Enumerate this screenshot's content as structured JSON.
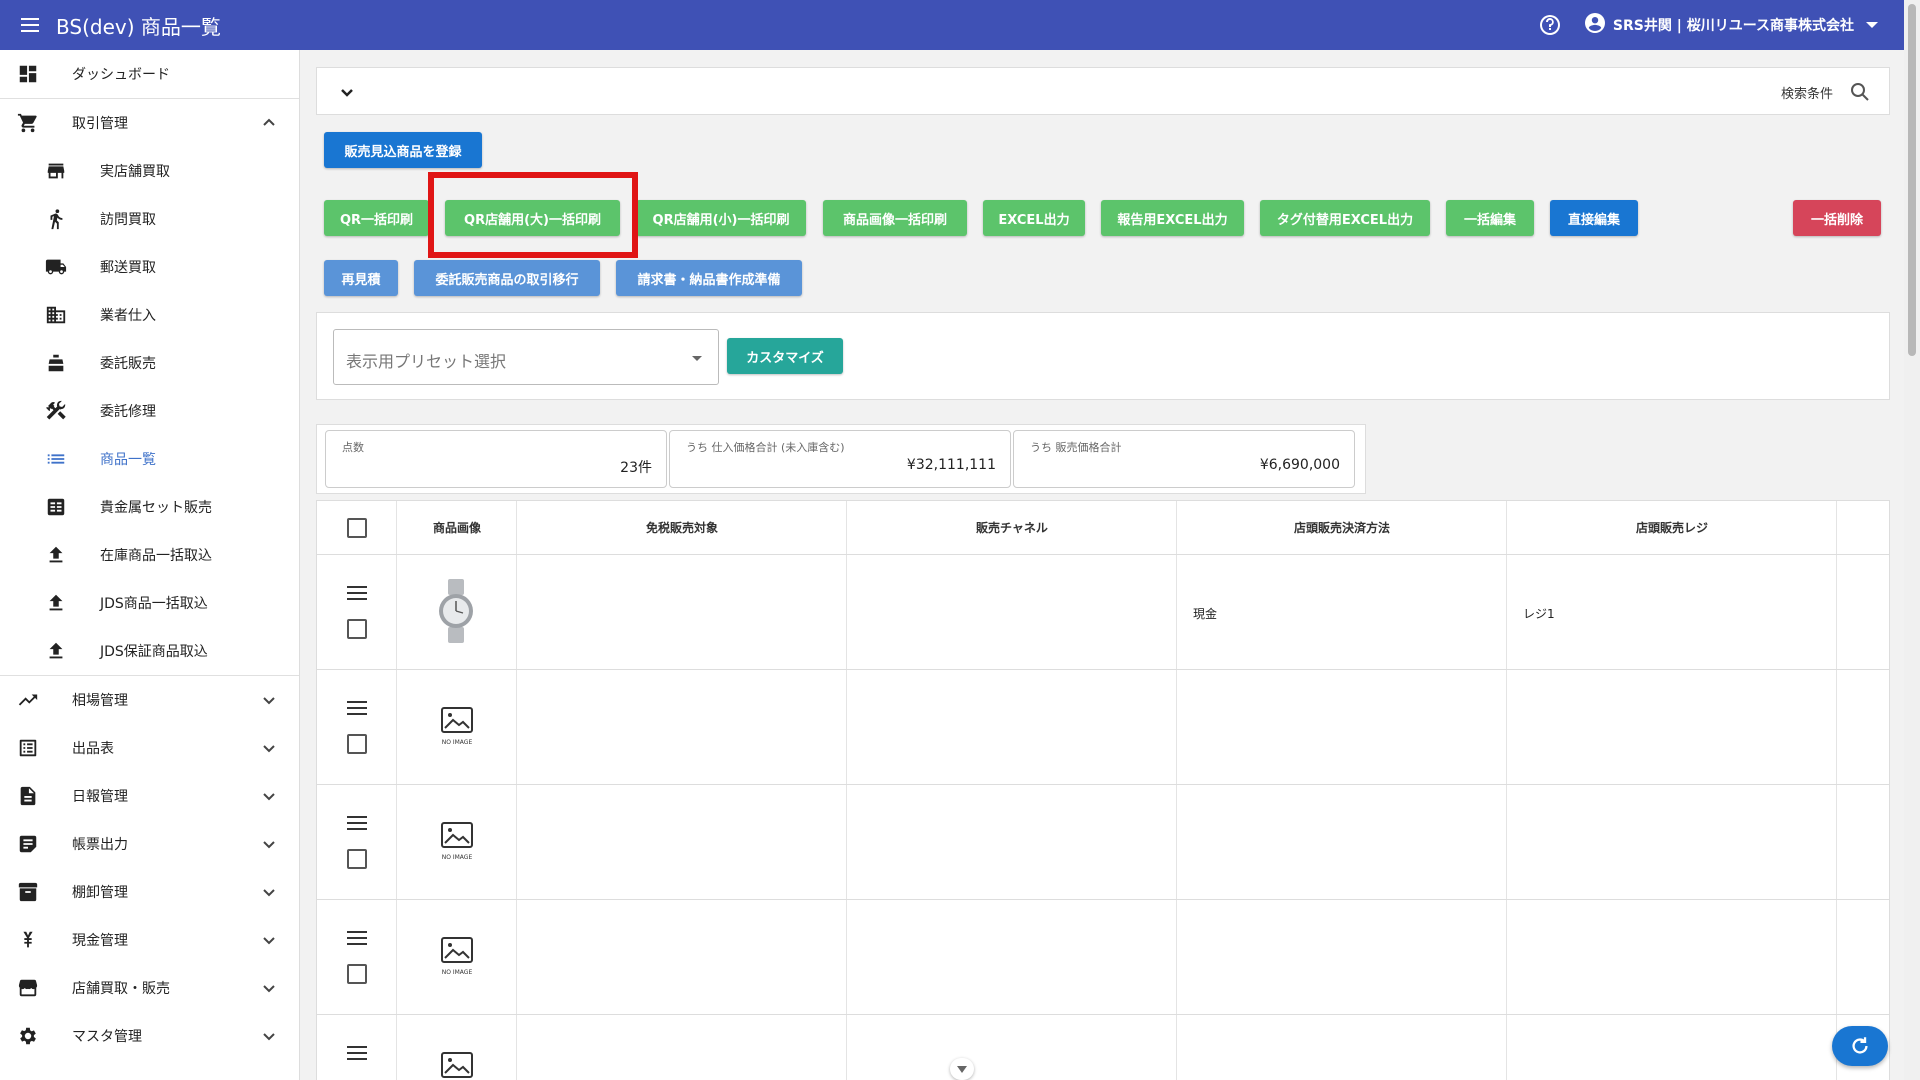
{
  "appbar": {
    "title": "BS(dev) 商品一覧",
    "user": "SRS井関 | 桜川リユース商事株式会社"
  },
  "sidebar": {
    "dashboard": "ダッシュボード",
    "trade": "取引管理",
    "sub": [
      "実店舗買取",
      "訪問買取",
      "郵送買取",
      "業者仕入",
      "委託販売",
      "委託修理",
      "商品一覧",
      "貴金属セット販売",
      "在庫商品一括取込",
      "JDS商品一括取込",
      "JDS保証商品取込"
    ],
    "groups": [
      "相場管理",
      "出品表",
      "日報管理",
      "帳票出力",
      "棚卸管理",
      "現金管理",
      "店舗買取・販売",
      "マスタ管理"
    ]
  },
  "search": {
    "label": "検索条件"
  },
  "buttons": {
    "register": "販売見込商品を登録",
    "qr_all": "QR一括印刷",
    "qr_large": "QR店舗用(大)一括印刷",
    "qr_small": "QR店舗用(小)一括印刷",
    "img_print": "商品画像一括印刷",
    "excel": "EXCEL出力",
    "report_excel": "報告用EXCEL出力",
    "tag_excel": "タグ付替用EXCEL出力",
    "bulk_edit": "一括編集",
    "direct_edit": "直接編集",
    "bulk_delete": "一括削除",
    "reestimate": "再見積",
    "consign_move": "委託販売商品の取引移行",
    "invoice": "請求書・納品書作成準備",
    "customize": "カスタマイズ"
  },
  "preset": {
    "placeholder": "表示用プリセット選択"
  },
  "stats": [
    {
      "label": "点数",
      "value": "23件"
    },
    {
      "label": "うち 仕入価格合計 (未入庫含む)",
      "value": "¥32,111,111"
    },
    {
      "label": "うち 販売価格合計",
      "value": "¥6,690,000"
    }
  ],
  "table": {
    "headers": [
      "商品画像",
      "免税販売対象",
      "販売チャネル",
      "店頭販売決済方法",
      "店頭販売レジ"
    ],
    "rows": [
      {
        "payment": "現金",
        "register": "レジ1"
      },
      {
        "payment": "",
        "register": ""
      },
      {
        "payment": "",
        "register": ""
      },
      {
        "payment": "",
        "register": ""
      },
      {
        "payment": "",
        "register": ""
      }
    ],
    "noimage": "NO IMAGE"
  },
  "colors": {
    "appbar": "#3f51b5",
    "green": "#5cc46b",
    "blue": "#1976d2",
    "red": "#d6455a",
    "teal": "#26a69a",
    "highlight": "#e01515"
  }
}
